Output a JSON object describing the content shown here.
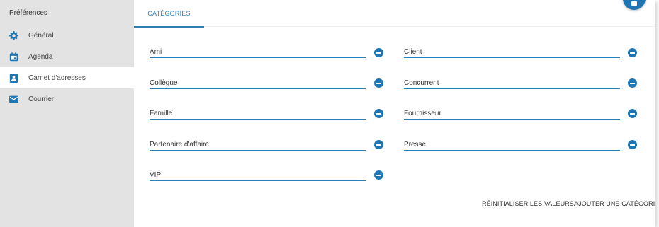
{
  "sidebar": {
    "title": "Préférences",
    "items": [
      {
        "label": "Général",
        "icon": "gear-icon"
      },
      {
        "label": "Agenda",
        "icon": "calendar-icon"
      },
      {
        "label": "Carnet d'adresses",
        "icon": "address-book-icon",
        "active": true
      },
      {
        "label": "Courrier",
        "icon": "mail-icon"
      }
    ]
  },
  "tab": {
    "label": "CATÉGORIES"
  },
  "categories": {
    "left": [
      "Ami",
      "Collègue",
      "Famille",
      "Partenaire d'affaire",
      "VIP"
    ],
    "right": [
      "Client",
      "Concurrent",
      "Fournisseur",
      "Presse"
    ]
  },
  "actions": {
    "reset_label": "RÉINITIALISER LES VALEURS",
    "add_label": "AJOUTER UNE CATÉGORIE"
  },
  "colors": {
    "accent": "#1f76b2",
    "sidebar_bg": "#e3e3e3"
  }
}
